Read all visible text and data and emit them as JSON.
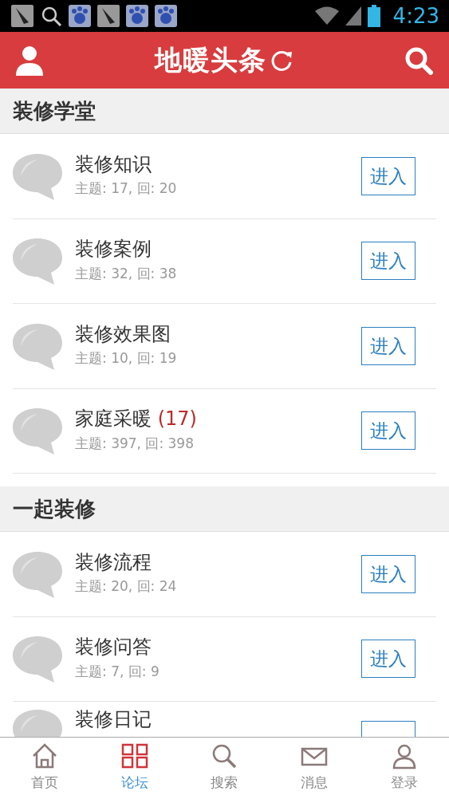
{
  "status_bar": {
    "time": "4:23",
    "notifications": [
      {
        "kind": "feather"
      },
      {
        "kind": "search"
      },
      {
        "kind": "paw"
      },
      {
        "kind": "feather"
      },
      {
        "kind": "paw"
      },
      {
        "kind": "paw"
      }
    ]
  },
  "header": {
    "title": "地暖头条"
  },
  "sections": [
    {
      "title": "装修学堂",
      "forums": [
        {
          "name": "装修知识",
          "stats": "主题: 17, 回: 20",
          "button": "进入"
        },
        {
          "name": "装修案例",
          "stats": "主题: 32, 回: 38",
          "button": "进入"
        },
        {
          "name": "装修效果图",
          "stats": "主题: 10, 回: 19",
          "button": "进入"
        },
        {
          "name": "家庭采暖",
          "new_count": "(17)",
          "stats": "主题: 397, 回: 398",
          "button": "进入"
        }
      ]
    },
    {
      "title": "一起装修",
      "forums": [
        {
          "name": "装修流程",
          "stats": "主题: 20, 回: 24",
          "button": "进入"
        },
        {
          "name": "装修问答",
          "stats": "主题: 7, 回: 9",
          "button": "进入"
        },
        {
          "name": "装修日记"
        }
      ]
    }
  ],
  "bottom_nav": [
    {
      "kind": "home",
      "label": "首页",
      "selected": false
    },
    {
      "kind": "grid",
      "label": "论坛",
      "selected": true
    },
    {
      "kind": "search",
      "label": "搜索",
      "selected": false
    },
    {
      "kind": "mail",
      "label": "消息",
      "selected": false
    },
    {
      "kind": "user",
      "label": "登录",
      "selected": false
    }
  ]
}
